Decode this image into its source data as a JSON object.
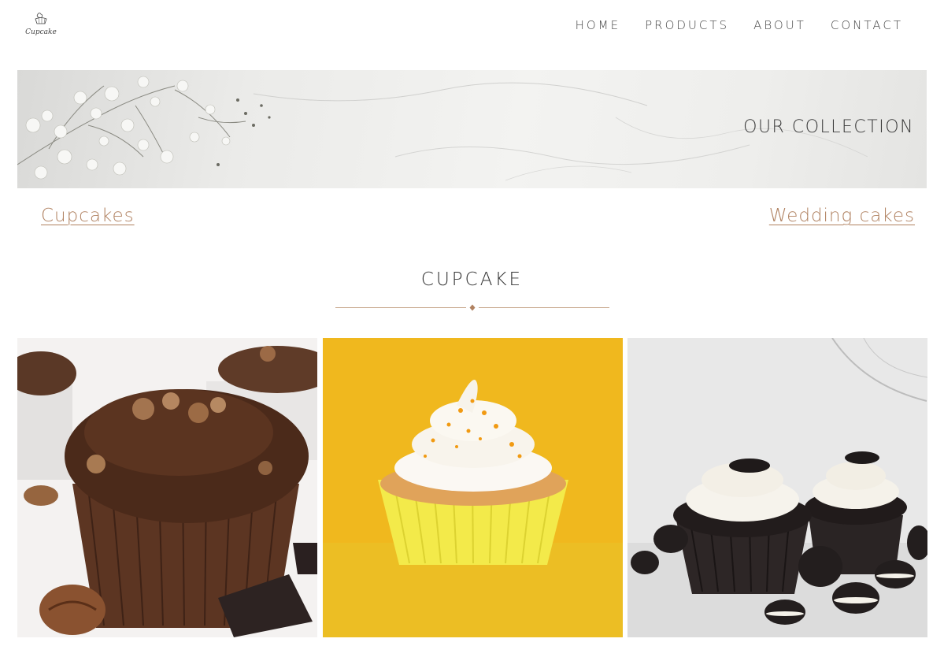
{
  "header": {
    "logo_text": "Cupcake",
    "nav": [
      {
        "label": "HOME"
      },
      {
        "label": "PRODUCTS"
      },
      {
        "label": "ABOUT"
      },
      {
        "label": "CONTACT"
      }
    ]
  },
  "banner": {
    "title": "OUR COLLECTION"
  },
  "categories": {
    "left": "Cupcakes",
    "right": "Wedding cakes"
  },
  "section": {
    "title": "CUPCAKE"
  },
  "colors": {
    "accent": "#b08160",
    "yellow_bg": "#f0b81e",
    "text": "#333333"
  },
  "products": [
    {
      "image": "chocolate-muffin-with-pecans"
    },
    {
      "image": "yellow-cupcake-with-sprinkles"
    },
    {
      "image": "oreo-chocolate-cupcakes"
    }
  ]
}
